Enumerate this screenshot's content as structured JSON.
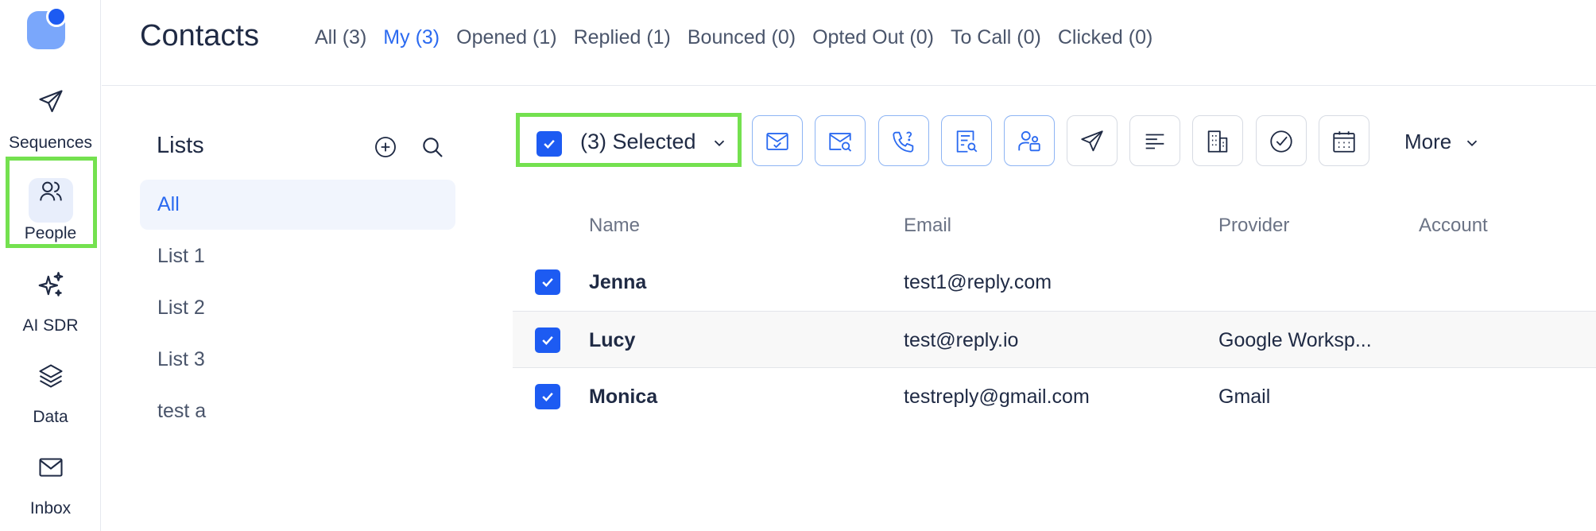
{
  "nav": {
    "items": [
      {
        "label": "Sequences",
        "icon": "send-icon"
      },
      {
        "label": "People",
        "icon": "people-icon"
      },
      {
        "label": "AI SDR",
        "icon": "sparkle-icon"
      },
      {
        "label": "Data",
        "icon": "layers-icon"
      },
      {
        "label": "Inbox",
        "icon": "mail-icon"
      }
    ],
    "active": "People"
  },
  "header": {
    "title": "Contacts",
    "tabs": [
      {
        "label": "All (3)"
      },
      {
        "label": "My (3)"
      },
      {
        "label": "Opened (1)"
      },
      {
        "label": "Replied (1)"
      },
      {
        "label": "Bounced (0)"
      },
      {
        "label": "Opted Out (0)"
      },
      {
        "label": "To Call (0)"
      },
      {
        "label": "Clicked (0)"
      }
    ],
    "active_tab": "My (3)"
  },
  "lists": {
    "title": "Lists",
    "items": [
      {
        "label": "All"
      },
      {
        "label": "List 1"
      },
      {
        "label": "List 2"
      },
      {
        "label": "List 3"
      },
      {
        "label": "test a"
      }
    ],
    "active": "All"
  },
  "toolbar": {
    "selected_label": "(3) Selected",
    "more_label": "More",
    "buttons": [
      {
        "icon": "mail-check-icon"
      },
      {
        "icon": "mail-search-icon"
      },
      {
        "icon": "phone-question-icon"
      },
      {
        "icon": "document-search-icon"
      },
      {
        "icon": "user-groups-icon"
      },
      {
        "icon": "send-icon"
      },
      {
        "icon": "align-left-icon"
      },
      {
        "icon": "building-icon"
      },
      {
        "icon": "check-circle-icon"
      },
      {
        "icon": "calendar-icon"
      }
    ]
  },
  "table": {
    "columns": [
      "Name",
      "Email",
      "Provider",
      "Account"
    ],
    "rows": [
      {
        "name": "Jenna",
        "email": "test1@reply.com",
        "provider": "",
        "checked": true
      },
      {
        "name": "Lucy",
        "email": "test@reply.io",
        "provider": "Google Worksp...",
        "checked": true
      },
      {
        "name": "Monica",
        "email": "testreply@gmail.com",
        "provider": "Gmail",
        "checked": true
      }
    ]
  },
  "colors": {
    "accent": "#2b6af0",
    "checkbox": "#1d5bf2",
    "highlight": "#74e14f"
  }
}
